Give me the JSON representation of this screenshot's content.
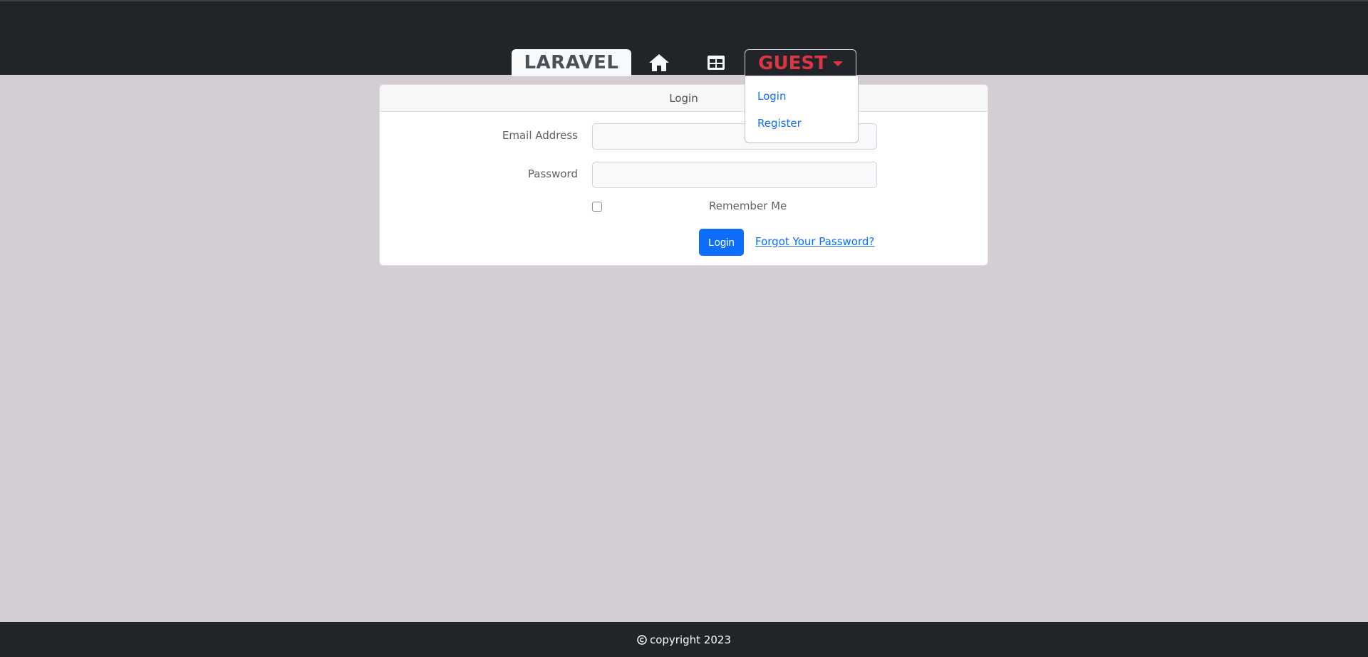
{
  "navbar": {
    "brand": "LARAVEL",
    "home_icon": "home-icon",
    "table_icon": "table-icon",
    "guest_label": "GUEST",
    "dropdown": {
      "items": [
        {
          "label": "Login"
        },
        {
          "label": "Register"
        }
      ]
    },
    "colors": {
      "background": "#212529",
      "guest": "#dc3545"
    }
  },
  "login_card": {
    "header": "Login",
    "email_label": "Email Address",
    "email_value": "",
    "password_label": "Password",
    "password_value": "",
    "remember_label": "Remember Me",
    "remember_checked": false,
    "submit_label": "Login",
    "forgot_label": "Forgot Your Password?"
  },
  "footer": {
    "copyright_icon": "copyright-icon",
    "text": "copyright 2023"
  },
  "colors": {
    "page_background": "#d4ced4",
    "primary": "#0d6efd"
  }
}
